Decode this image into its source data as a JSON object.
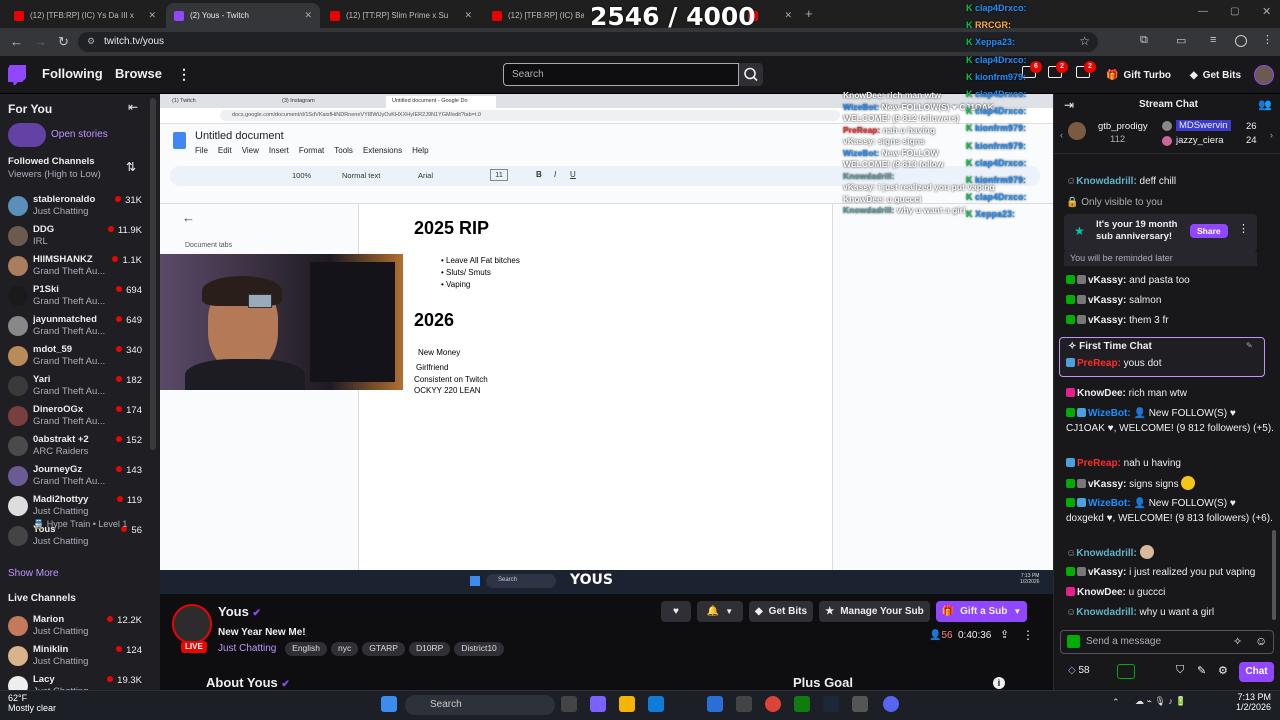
{
  "counter": "2546 / 4000",
  "browser": {
    "tabs": [
      {
        "label": "(12) [TFB:RP] (IC) Ys Da III x",
        "active": false
      },
      {
        "label": "(2) Yous - Twitch",
        "active": true
      },
      {
        "label": "(12) [TT:RP] Slim Prime x Su",
        "active": false
      },
      {
        "label": "(12) [TFB:RP] (IC) Bang 8",
        "active": false
      }
    ],
    "url": "twitch.tv/yous"
  },
  "topnav": {
    "following": "Following",
    "browse": "Browse",
    "search_placeholder": "Search",
    "notif_count": "2",
    "inbox_count": "6",
    "gift_turbo": "Gift Turbo",
    "get_bits": "Get Bits"
  },
  "sidebar": {
    "for_you": "For You",
    "open_stories": "Open stories",
    "followed_title": "Followed Channels",
    "sort": "Viewers (High to Low)",
    "channels": [
      {
        "name": "stableronaldo",
        "game": "Just Chatting",
        "viewers": "31K",
        "color": "#5b8fb9"
      },
      {
        "name": "DDG",
        "game": "IRL",
        "viewers": "11.9K",
        "color": "#6d5a4e"
      },
      {
        "name": "HIIMSHANKZ",
        "game": "Grand Theft Au...",
        "viewers": "1.1K",
        "color": "#a97d5d"
      },
      {
        "name": "P1Ski",
        "game": "Grand Theft Au...",
        "viewers": "694",
        "color": "#1a1a1a"
      },
      {
        "name": "jayunmatched",
        "game": "Grand Theft Au...",
        "viewers": "649",
        "color": "#888"
      },
      {
        "name": "mdot_59",
        "game": "Grand Theft Au...",
        "viewers": "340",
        "color": "#b98b5a"
      },
      {
        "name": "Yari",
        "game": "Grand Theft Au...",
        "viewers": "182",
        "color": "#3a3a3a"
      },
      {
        "name": "DineroOGx",
        "game": "Grand Theft Au...",
        "viewers": "174",
        "color": "#7a3e3e"
      },
      {
        "name": "0abstrakt +2",
        "game": "ARC Raiders",
        "viewers": "152",
        "color": "#4a4a4a"
      },
      {
        "name": "JourneyGz",
        "game": "Grand Theft Au...",
        "viewers": "143",
        "color": "#6b5b95"
      },
      {
        "name": "Madi2hottyy",
        "game": "Just Chatting",
        "viewers": "119",
        "color": "#ddd"
      },
      {
        "name": "Yous",
        "game": "Just Chatting",
        "viewers": "56",
        "color": "#444"
      }
    ],
    "hype_train": "Hype Train • Level 1",
    "show_more": "Show More",
    "live_title": "Live Channels",
    "live": [
      {
        "name": "Marion",
        "game": "Just Chatting",
        "viewers": "12.2K",
        "color": "#c47a5a"
      },
      {
        "name": "Miniklin",
        "game": "Just Chatting",
        "viewers": "124",
        "color": "#d9b38c"
      },
      {
        "name": "Lacy",
        "game": "Just Chatting",
        "viewers": "19.3K",
        "color": "#eee"
      }
    ]
  },
  "video": {
    "inner_tabs": [
      "(1) Twitch",
      "(3) Instagram",
      "Untitled document - Google Do"
    ],
    "inner_url": "docs.google.com/document/d/1SdVKaisfHiNDRneneVYI8WUyOvKHXXHyIER2J9N1YGM/edit?tab=t.0",
    "doc_title": "Untitled document",
    "doc_menu": [
      "File",
      "Edit",
      "View",
      "Insert",
      "Format",
      "Tools",
      "Extensions",
      "Help"
    ],
    "zoom": "100%",
    "style": "Normal text",
    "font": "Arial",
    "font_size": "11",
    "doc_tabs": "Document tabs",
    "h1": "2025 RIP",
    "bullets": [
      "Leave All Fat bitches",
      "Sluts/ Smuts",
      "Vaping"
    ],
    "h2": "2026",
    "lines": [
      "New Money",
      "Girlfriend",
      "Consistent on Twitch",
      "OCKYY 220 LEAN"
    ],
    "overlay_chat": [
      {
        "user": "KnowDee:",
        "msg": " rich man wtw",
        "color": "#fff"
      },
      {
        "user": "WizeBot:",
        "msg": " New FOLLOW(S) ♥ CJ1OAK",
        "color": "#1e90ff"
      },
      {
        "user": "",
        "msg": "WELCOME! (9 812 followers)",
        "color": "#fff"
      },
      {
        "user": "PreReap:",
        "msg": " nah u having",
        "color": "#ff2b2b"
      },
      {
        "user": "vKassy:",
        "msg": " signs signs",
        "color": "#fff"
      },
      {
        "user": "WizeBot:",
        "msg": " New FOLLOW",
        "color": "#1e90ff"
      },
      {
        "user": "",
        "msg": "WELCOME! (9 813 follow",
        "color": "#fff"
      },
      {
        "user": "Knowdadrill:",
        "msg": "",
        "color": "#5f9ea0"
      },
      {
        "user": "vKassy:",
        "msg": " i just realized you put vaping",
        "color": "#fff"
      },
      {
        "user": "KnowDee:",
        "msg": " u guccci",
        "color": "#fff"
      },
      {
        "user": "Knowdadrill:",
        "msg": " why u want a girl",
        "color": "#5f9ea0"
      }
    ],
    "overlay_names": [
      "clap4Drxco:",
      "RRCGR:",
      "Xeppa23:",
      "clap4Drxco:",
      "kionfrm979:",
      "clap4Drxco:",
      "clap4Drxco:",
      "kionfrm979:",
      "kionfrm979:",
      "clap4Drxco:",
      "kionfrm979:",
      "clap4Drxco:",
      "Xeppa23:"
    ],
    "search_label": "Search",
    "inner_time": "7:13 PM",
    "inner_date": "1/2/2026",
    "watermark": "YOUS"
  },
  "stream": {
    "channel": "Yous",
    "title": "New Year New Me!",
    "live": "LIVE",
    "category": "Just Chatting",
    "tags": [
      "English",
      "nyc",
      "GTARP",
      "D10RP",
      "District10"
    ],
    "viewers": "56",
    "uptime": "0:40:36",
    "get_bits": "Get Bits",
    "manage_sub": "Manage Your Sub",
    "gift_sub": "Gift a Sub",
    "about": "About Yous",
    "plus_goal": "Plus Goal"
  },
  "chat": {
    "title": "Stream Chat",
    "leaders": [
      {
        "name": "gtb_prodigy",
        "count": "112"
      },
      {
        "name": "MDSwervin",
        "count": "26"
      },
      {
        "name": "jazzy_ciera",
        "count": "24"
      }
    ],
    "only_visible": "Only visible to you",
    "anniv": "It's your 19 month sub anniversary!",
    "share": "Share",
    "reminded": "You will be reminded later",
    "first_time": "First Time Chat",
    "messages": [
      {
        "user": "Knowdadrill:",
        "text": " deff chill",
        "color": "#5fb3c9"
      },
      {
        "user": "vKassy:",
        "text": " and pasta too",
        "color": "#efeff1"
      },
      {
        "user": "vKassy:",
        "text": " salmon",
        "color": "#efeff1"
      },
      {
        "user": "vKassy:",
        "text": " them 3 fr",
        "color": "#efeff1"
      },
      {
        "user": "PreReap:",
        "text": " yous dot",
        "color": "#ff2b2b"
      },
      {
        "user": "KnowDee:",
        "text": " rich man wtw",
        "color": "#efeff1"
      },
      {
        "user": "WizeBot:",
        "text": " 👤 New FOLLOW(S) ♥ CJ1OAK ♥, WELCOME! (9 812 followers) (+5).",
        "color": "#1e90ff"
      },
      {
        "user": "PreReap:",
        "text": " nah u having",
        "color": "#ff2b2b"
      },
      {
        "user": "vKassy:",
        "text": " signs signs",
        "color": "#efeff1"
      },
      {
        "user": "WizeBot:",
        "text": " 👤 New FOLLOW(S) ♥ doxgekd ♥, WELCOME! (9 813 followers) (+6).",
        "color": "#1e90ff"
      },
      {
        "user": "Knowdadrill:",
        "text": "",
        "color": "#5fb3c9"
      },
      {
        "user": "vKassy:",
        "text": " i just realized you put vaping",
        "color": "#efeff1"
      },
      {
        "user": "KnowDee:",
        "text": " u guccci",
        "color": "#efeff1"
      },
      {
        "user": "Knowdadrill:",
        "text": " why u want a girl",
        "color": "#5fb3c9"
      }
    ],
    "placeholder": "Send a message",
    "points": "58",
    "chat_btn": "Chat"
  },
  "taskbar": {
    "temp": "62°F",
    "weather": "Mostly clear",
    "search": "Search",
    "time": "7:13 PM",
    "date": "1/2/2026"
  }
}
